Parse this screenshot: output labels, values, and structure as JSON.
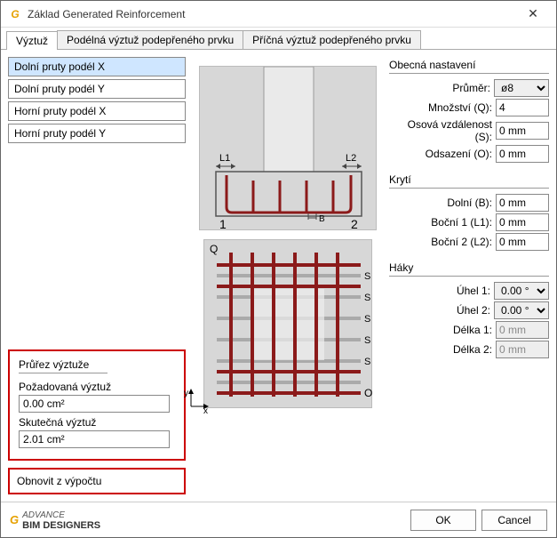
{
  "window": {
    "title": "Základ Generated Reinforcement"
  },
  "tabs": [
    {
      "label": "Výztuž",
      "active": true
    },
    {
      "label": "Podélná výztuž podepřeného prvku",
      "active": false
    },
    {
      "label": "Příčná výztuž podepřeného prvku",
      "active": false
    }
  ],
  "bars": [
    {
      "label": "Dolní pruty podél X",
      "selected": true
    },
    {
      "label": "Dolní pruty podél Y",
      "selected": false
    },
    {
      "label": "Horní pruty podél X",
      "selected": false
    },
    {
      "label": "Horní pruty podél Y",
      "selected": false
    }
  ],
  "section": {
    "title": "Průřez výztuže",
    "required_label": "Požadovaná výztuž",
    "required_value": "0.00 cm²",
    "actual_label": "Skutečná výztuž",
    "actual_value": "2.01 cm²"
  },
  "restore_label": "Obnovit z výpočtu",
  "diagram_labels": {
    "L1": "L1",
    "L2": "L2",
    "B": "B",
    "n1": "1",
    "n2": "2",
    "Q": "Q",
    "O": "O",
    "S": "S",
    "y": "y",
    "x": "x"
  },
  "groups": {
    "general": {
      "title": "Obecná nastavení",
      "diameter_label": "Průměr:",
      "diameter_value": "ø8",
      "qty_label": "Množství (Q):",
      "qty_value": "4",
      "spacing_label": "Osová vzdálenost (S):",
      "spacing_value": "0 mm",
      "offset_label": "Odsazení (O):",
      "offset_value": "0 mm"
    },
    "cover": {
      "title": "Krytí",
      "bottom_label": "Dolní (B):",
      "bottom_value": "0 mm",
      "side1_label": "Boční 1 (L1):",
      "side1_value": "0 mm",
      "side2_label": "Boční 2 (L2):",
      "side2_value": "0 mm"
    },
    "hooks": {
      "title": "Háky",
      "angle1_label": "Úhel 1:",
      "angle1_value": "0.00 °",
      "angle2_label": "Úhel 2:",
      "angle2_value": "0.00 °",
      "len1_label": "Délka 1:",
      "len1_value": "0 mm",
      "len2_label": "Délka 2:",
      "len2_value": "0 mm"
    }
  },
  "footer": {
    "brand_top": "ADVANCE",
    "brand_main": "BIM DESIGNERS",
    "ok": "OK",
    "cancel": "Cancel"
  }
}
